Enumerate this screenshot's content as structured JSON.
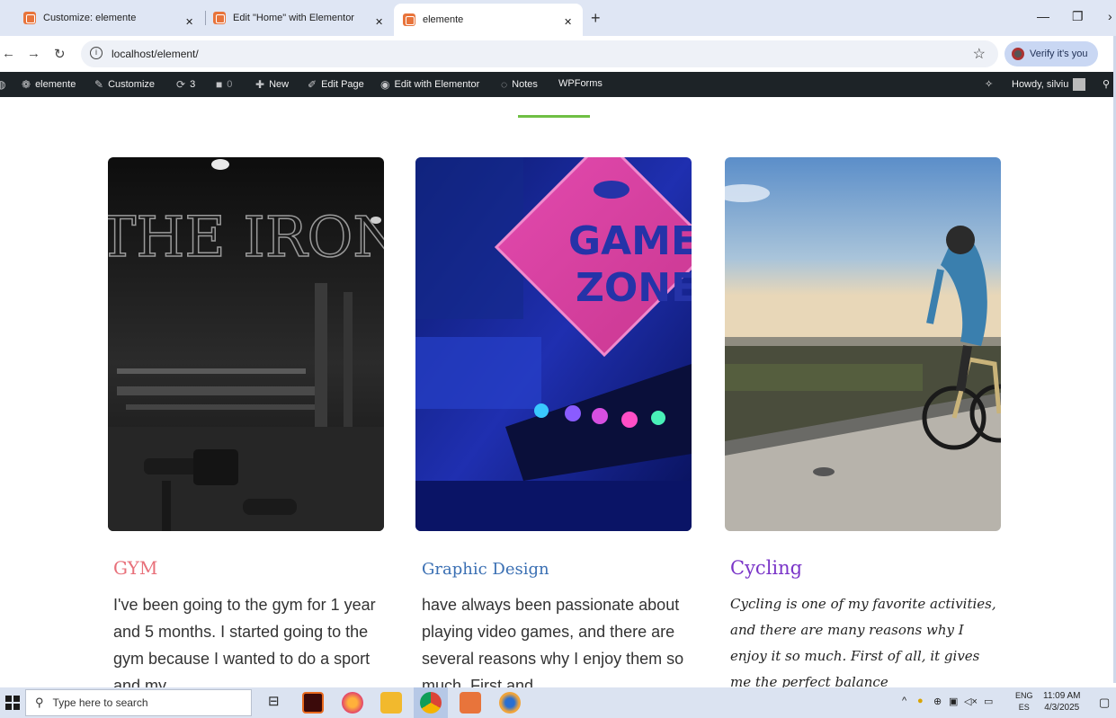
{
  "browser": {
    "tabs": [
      {
        "title": "Customize: elemente"
      },
      {
        "title": "Edit \"Home\" with Elementor"
      },
      {
        "title": "elemente"
      }
    ],
    "new_tab_glyph": "+",
    "url": "localhost/element/",
    "verify_label": "Verify it's you"
  },
  "adminbar": {
    "site": "elemente",
    "customize": "Customize",
    "updates": "3",
    "comments": "0",
    "new": "New",
    "edit_page": "Edit Page",
    "edit_elementor": "Edit with Elementor",
    "notes": "Notes",
    "wpforms": "WPForms",
    "howdy": "Howdy, silviu"
  },
  "cards": [
    {
      "title": "GYM",
      "title_color": "#e8707a",
      "image": "gym-photo",
      "text": "I've been going to the gym for 1 year and 5 months. I started going to the gym because I wanted to do a sport and my"
    },
    {
      "title": "Graphic Design",
      "title_color": "#3a6fb3",
      "image": "game-zone-photo",
      "text": "have always been passionate about playing video games, and there are several reasons why I enjoy them so much. First and"
    },
    {
      "title": "Cycling",
      "title_color": "#7a35c8",
      "image": "cycling-photo",
      "text": "Cycling is one of my favorite activities, and there are many reasons why I enjoy it so much. First of all, it gives me the perfect balance"
    }
  ],
  "taskbar": {
    "search_placeholder": "Type here to search",
    "lang_top": "ENG",
    "lang_bottom": "ES",
    "time": "11:09 AM",
    "date": "4/3/2025"
  },
  "colors": {
    "accent_line": "#6fbf44",
    "adminbar_bg": "#1d2327"
  }
}
